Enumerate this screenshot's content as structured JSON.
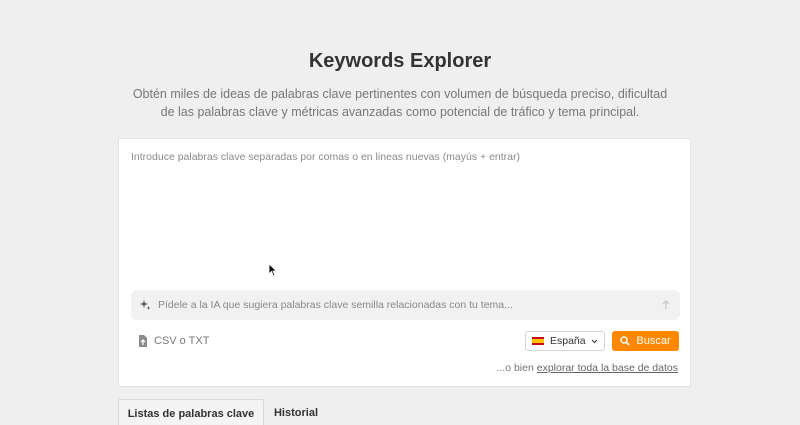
{
  "header": {
    "title": "Keywords Explorer",
    "subtitle_line1": "Obtén miles de ideas de palabras clave pertinentes con volumen de búsqueda preciso, dificultad",
    "subtitle_line2": "de las palabras clave y métricas avanzadas como potencial de tráfico y tema principal."
  },
  "editor": {
    "placeholder": "Introduce palabras clave separadas por comas o en lineas nuevas (mayús + entrar)",
    "value": ""
  },
  "ai": {
    "placeholder": "Pídele a la IA que sugiera palabras clave semilla relacionadas con tu tema..."
  },
  "toolbar": {
    "csv_label": "CSV o TXT",
    "country": "España",
    "search_label": "Buscar"
  },
  "explore": {
    "prefix": "...o bien ",
    "link": "explorar toda la base de datos"
  },
  "tabs": [
    {
      "label": "Listas de palabras clave",
      "active": true
    },
    {
      "label": "Historial",
      "active": false
    }
  ],
  "colors": {
    "accent": "#ff8800",
    "background": "#efefef"
  }
}
